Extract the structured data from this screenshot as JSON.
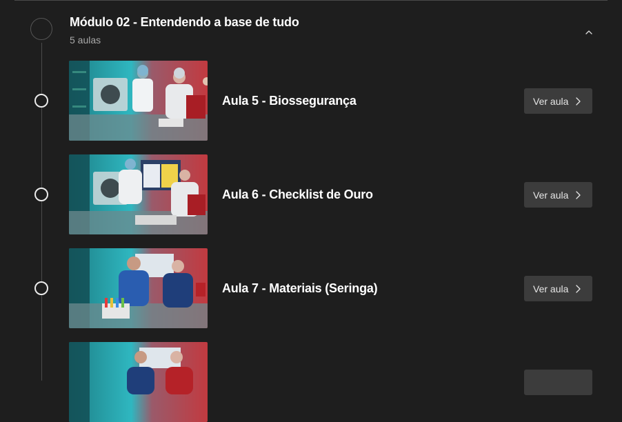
{
  "module": {
    "title": "Módulo 02 - Entendendo a base de tudo",
    "lesson_count": "5 aulas",
    "collapse_icon": "chevron-up-icon"
  },
  "lessons": [
    {
      "title": "Aula 5 - Biossegurança",
      "button": "Ver aula"
    },
    {
      "title": "Aula 6 - Checklist de Ouro",
      "button": "Ver aula"
    },
    {
      "title": "Aula 7 - Materiais (Seringa)",
      "button": "Ver aula"
    },
    {
      "title": "",
      "button": ""
    }
  ],
  "colors": {
    "background": "#1e1e1e",
    "button_bg": "#3c3c3c",
    "thumb_cyan": "#1fb3bd",
    "thumb_red": "#c0393f"
  }
}
